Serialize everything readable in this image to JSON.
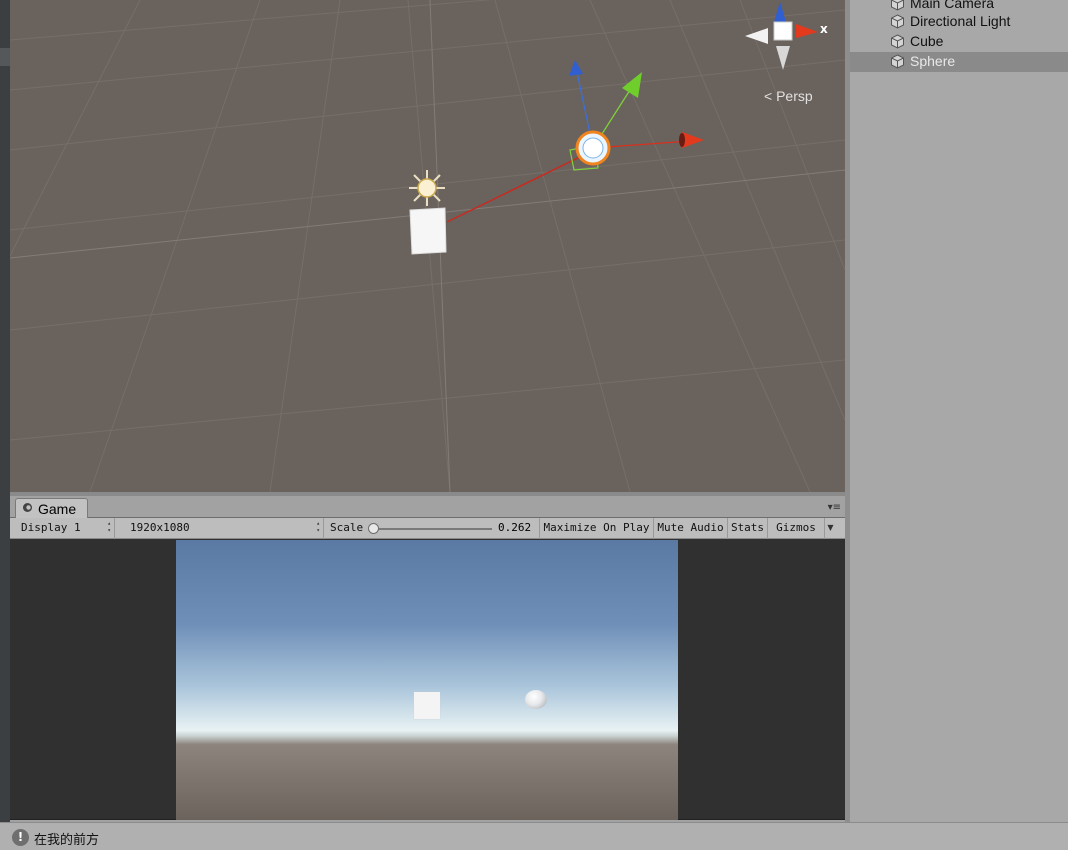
{
  "scene": {
    "persp_label": "Persp",
    "axis_x_label": "x"
  },
  "game_panel": {
    "tab_label": "Game",
    "toolbar": {
      "display_label": "Display 1",
      "resolution_label": "1920x1080",
      "scale_label": "Scale",
      "scale_value": "0.262",
      "maximize_label": "Maximize On Play",
      "mute_label": "Mute Audio",
      "stats_label": "Stats",
      "gizmos_label": "Gizmos"
    }
  },
  "hierarchy": {
    "items": [
      {
        "label": "Main Camera",
        "icon": "gameobject-icon",
        "selected": false
      },
      {
        "label": "Directional Light",
        "icon": "gameobject-icon",
        "selected": false
      },
      {
        "label": "Cube",
        "icon": "gameobject-icon",
        "selected": false
      },
      {
        "label": "Sphere",
        "icon": "gameobject-icon",
        "selected": true
      }
    ]
  },
  "status_bar": {
    "icon": "warning-icon",
    "message": "在我的前方"
  },
  "colors": {
    "axis_x": "#d8301e",
    "axis_y": "#7ed13b",
    "axis_z": "#3d6fd6",
    "selection_outline": "#f0841e",
    "scene_bg": "#6a625c"
  }
}
